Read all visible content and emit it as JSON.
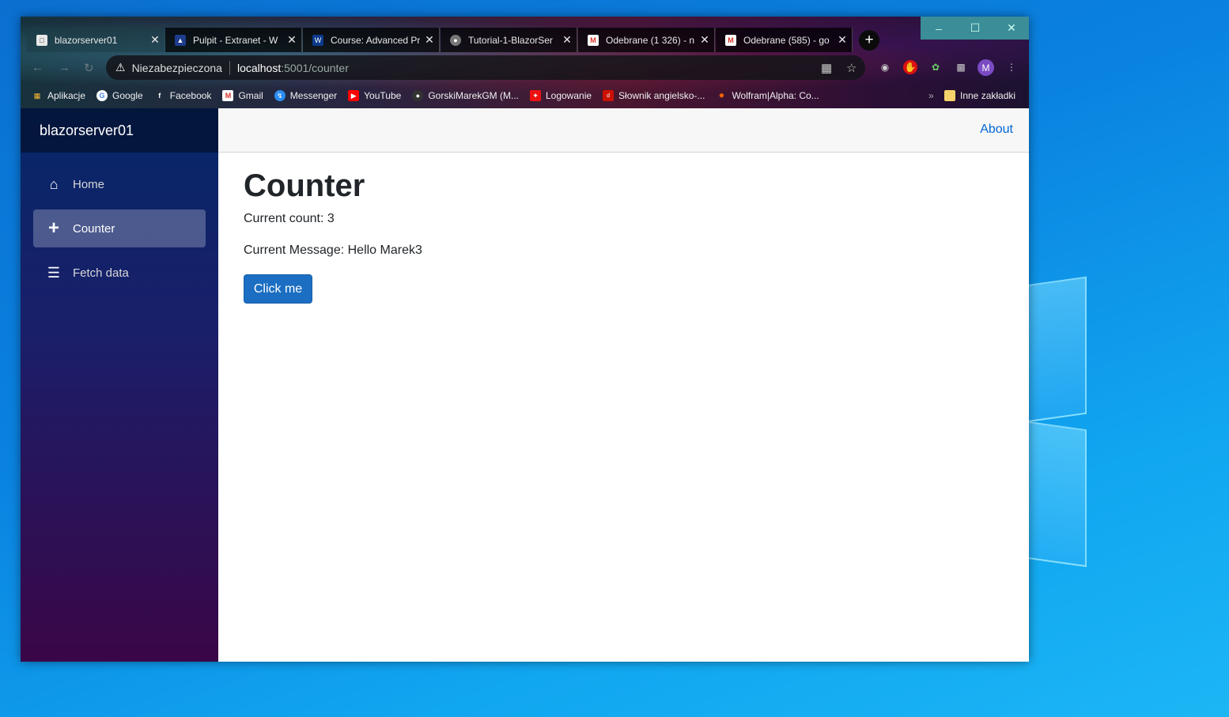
{
  "browser": {
    "tabs": [
      {
        "title": "blazorserver01",
        "favicon": "page-icon",
        "active": true
      },
      {
        "title": "Pulpit - Extranet - W",
        "favicon": "wsb-icon",
        "active": false
      },
      {
        "title": "Course: Advanced Pr",
        "favicon": "wsb-course-icon",
        "active": false
      },
      {
        "title": "Tutorial-1-BlazorSer",
        "favicon": "globe-icon",
        "active": false
      },
      {
        "title": "Odebrane (1 326) - n",
        "favicon": "gmail-icon",
        "active": false
      },
      {
        "title": "Odebrane (585) - go",
        "favicon": "gmail-icon",
        "active": false
      }
    ],
    "address": {
      "security_label": "Niezabezpieczona",
      "host": "localhost",
      "path": ":5001/counter"
    },
    "profile_initial": "M",
    "bookmarks": [
      {
        "label": "Aplikacje",
        "icon": "apps-grid-icon"
      },
      {
        "label": "Google",
        "icon": "google-icon"
      },
      {
        "label": "Facebook",
        "icon": "facebook-icon"
      },
      {
        "label": "Gmail",
        "icon": "gmail-icon"
      },
      {
        "label": "Messenger",
        "icon": "messenger-icon"
      },
      {
        "label": "YouTube",
        "icon": "youtube-icon"
      },
      {
        "label": "GorskiMarekGM (M...",
        "icon": "github-icon"
      },
      {
        "label": "Logowanie",
        "icon": "santander-icon"
      },
      {
        "label": "Słownik angielsko-...",
        "icon": "diki-icon"
      },
      {
        "label": "Wolfram|Alpha: Co...",
        "icon": "wolfram-icon"
      }
    ],
    "other_bookmarks": "Inne zakładki"
  },
  "app": {
    "brand": "blazorserver01",
    "nav": [
      {
        "label": "Home",
        "icon": "home-icon"
      },
      {
        "label": "Counter",
        "icon": "plus-icon",
        "active": true
      },
      {
        "label": "Fetch data",
        "icon": "list-icon"
      }
    ],
    "top_link": "About",
    "page": {
      "title": "Counter",
      "count_text": "Current count: 3",
      "message_text": "Current Message: Hello Marek3",
      "button_label": "Click me"
    }
  },
  "colors": {
    "accent_blue": "#1b6ec2",
    "link_blue": "#0366d6",
    "sidebar_top": "#052767",
    "sidebar_bottom": "#3a0647"
  }
}
